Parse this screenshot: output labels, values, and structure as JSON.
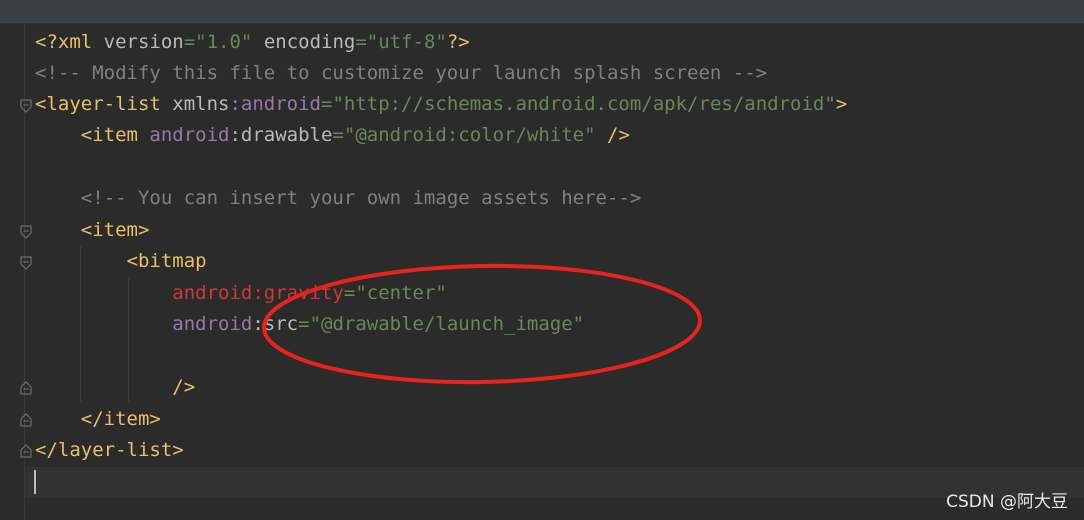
{
  "editor": {
    "lines": {
      "l1": {
        "a": "<?xml ",
        "b": "version",
        "c": "=",
        "d": "\"1.0\"",
        "e": " encoding",
        "f": "=",
        "g": "\"utf-8\"",
        "h": "?>"
      },
      "l2": {
        "a": "<!-- Modify this file to customize your launch splash screen -->"
      },
      "l3": {
        "a": "<layer-list ",
        "b": "xmlns",
        "c": ":android",
        "d": "=",
        "e": "\"http://schemas.android.com/apk/res/android\"",
        "f": ">"
      },
      "l4": {
        "indent": "    ",
        "a": "<item ",
        "b": "android",
        "c": ":drawable",
        "d": "=",
        "e": "\"@android:color/white\"",
        "f": " />"
      },
      "l6": {
        "indent": "    ",
        "a": "<!-- You can insert your own image assets here-->"
      },
      "l7": {
        "indent": "    ",
        "a": "<item>"
      },
      "l8": {
        "indent": "        ",
        "a": "<bitmap"
      },
      "l9": {
        "indent": "            ",
        "a": "android:gravity",
        "b": "=",
        "c": "\"center\""
      },
      "l10": {
        "indent": "            ",
        "a": "android",
        "b": ":src",
        "c": "=",
        "d": "\"@drawable/launch_image\""
      },
      "l12": {
        "indent": "            ",
        "a": "/>"
      },
      "l13": {
        "indent": "    ",
        "a": "</item>"
      },
      "l14": {
        "a": "</layer-list>"
      }
    }
  },
  "watermark": {
    "text": "CSDN @阿大豆"
  },
  "colors": {
    "background": "#2b2b2b",
    "tag": "#e8bf6a",
    "string": "#6a8759",
    "comment": "#808080",
    "namespace": "#9876aa",
    "annotation_ellipse": "#e8231e"
  }
}
